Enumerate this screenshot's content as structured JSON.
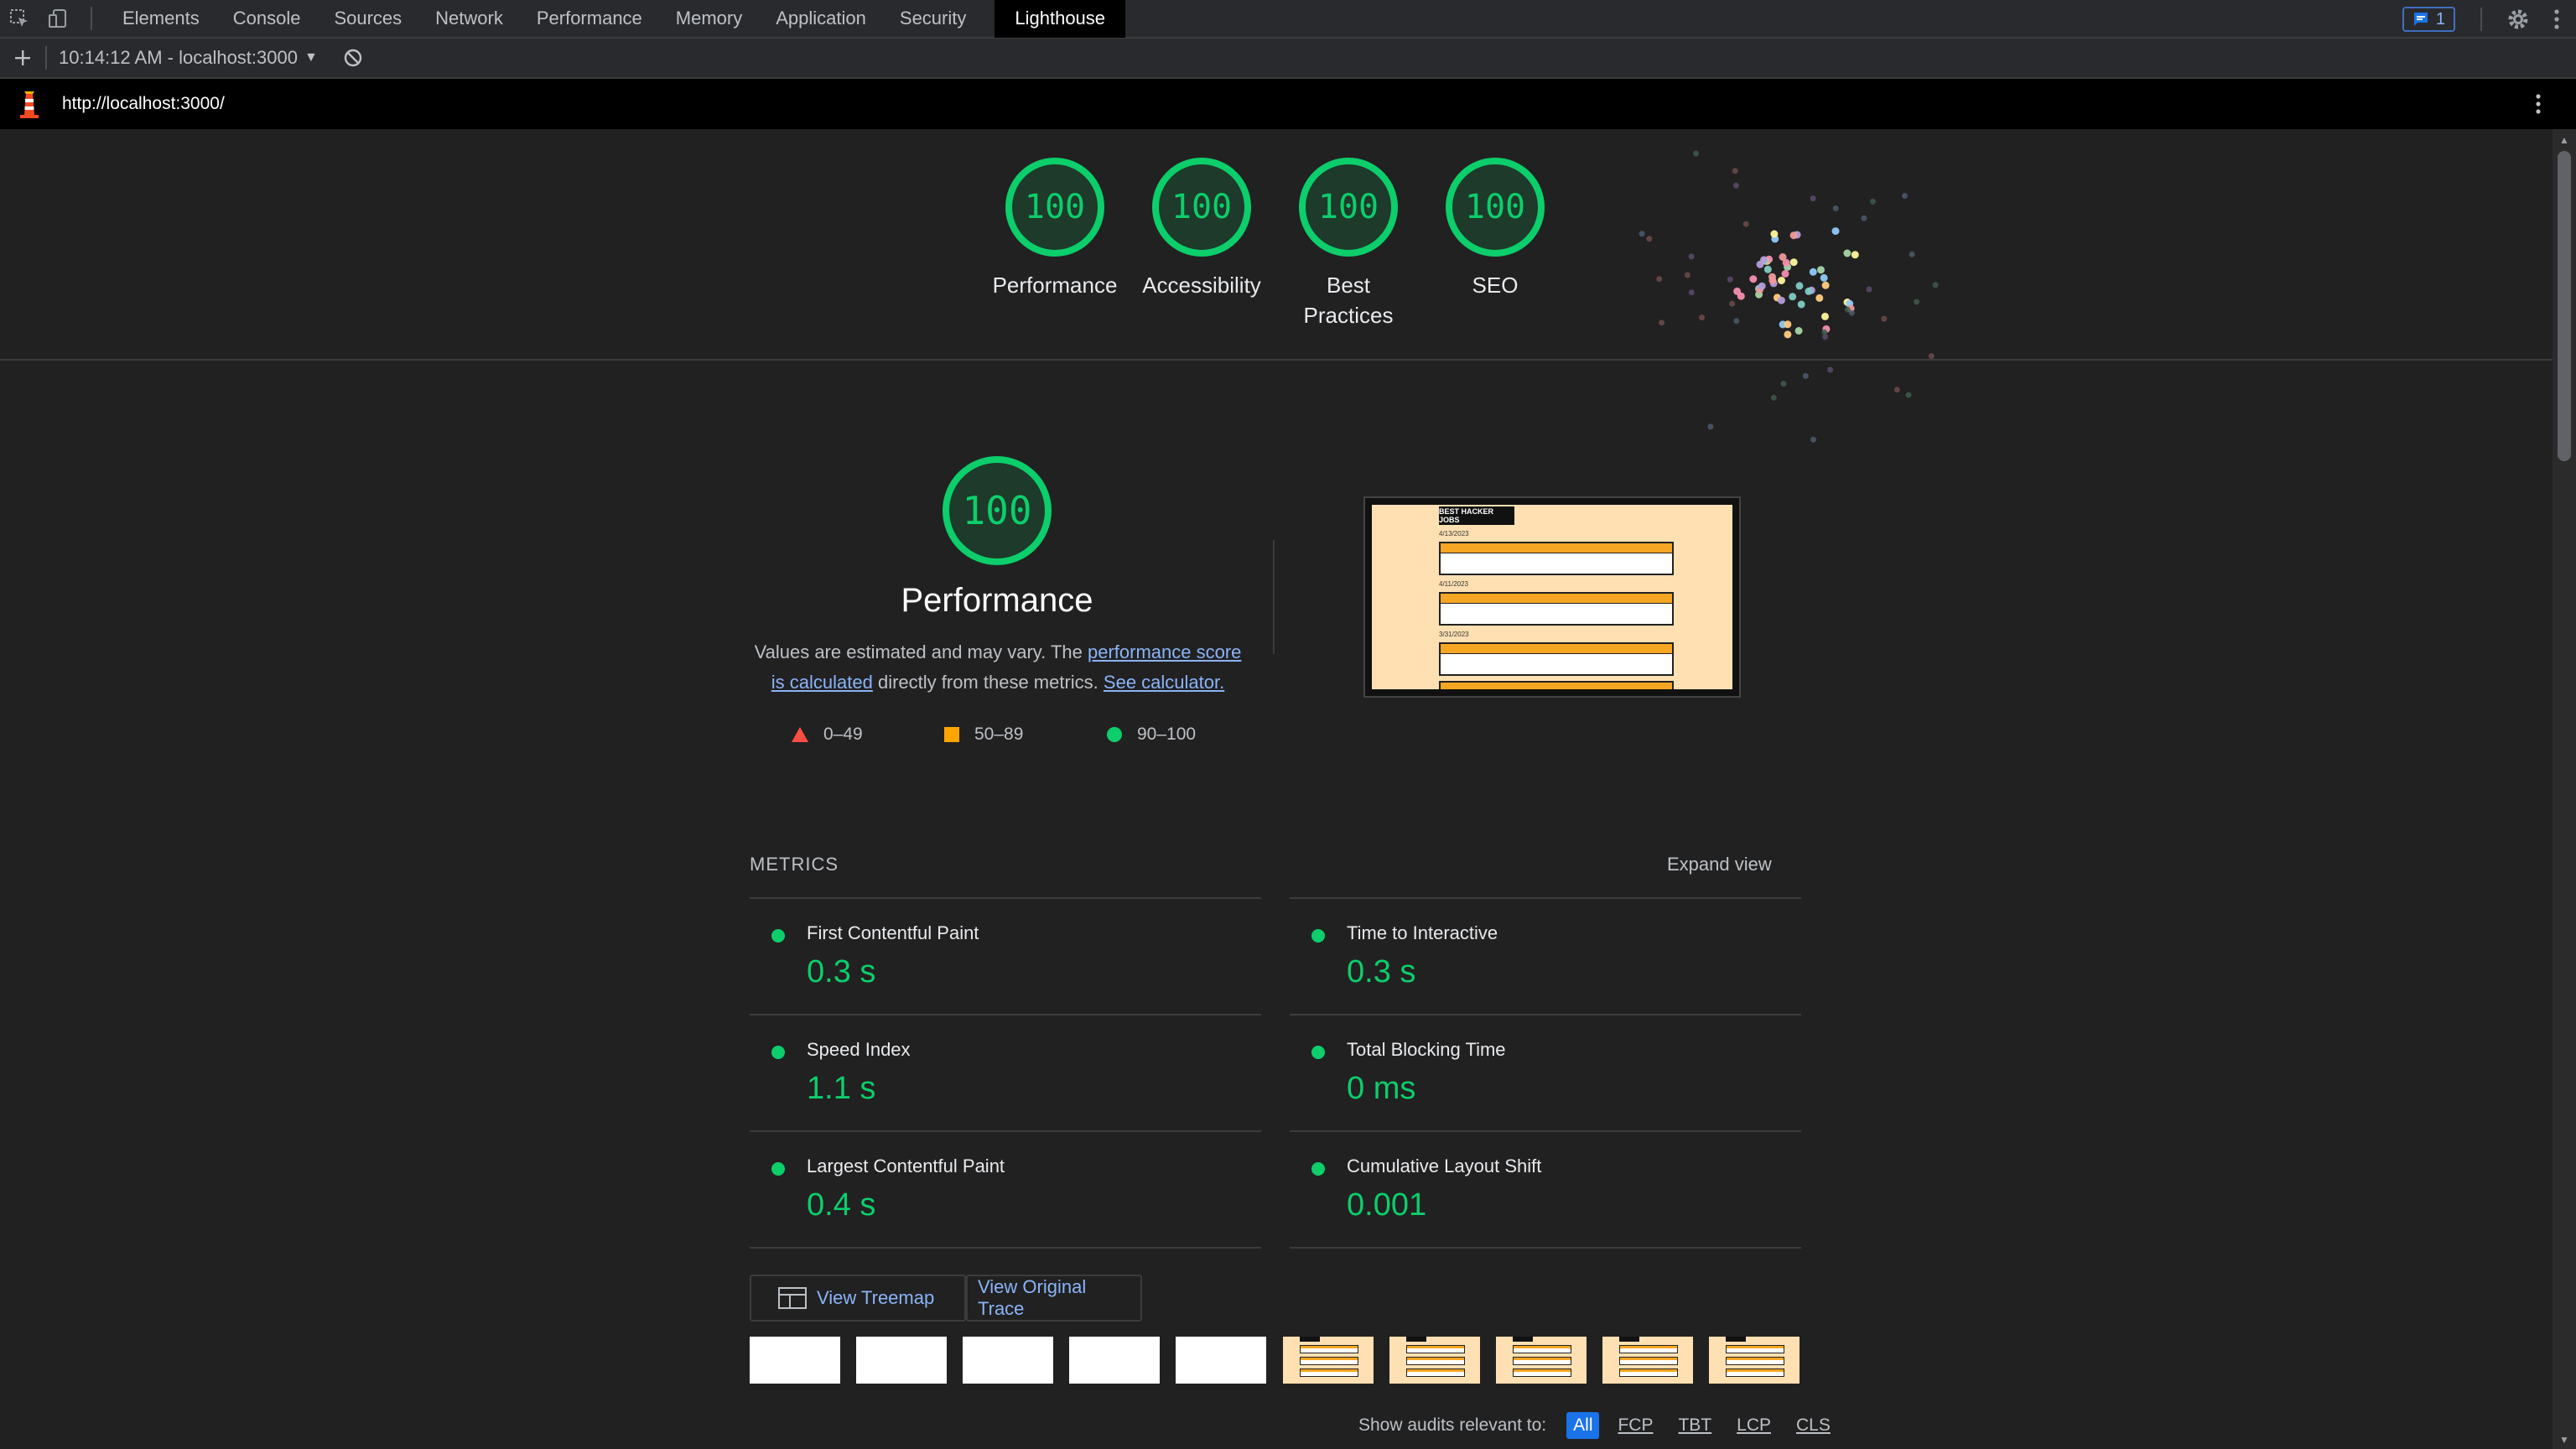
{
  "devtools": {
    "tabs": [
      {
        "label": "Elements"
      },
      {
        "label": "Console"
      },
      {
        "label": "Sources"
      },
      {
        "label": "Network"
      },
      {
        "label": "Performance"
      },
      {
        "label": "Memory"
      },
      {
        "label": "Application"
      },
      {
        "label": "Security"
      },
      {
        "label": "Lighthouse"
      }
    ],
    "active_tab": "Lighthouse",
    "issues_count": "1",
    "report_selector": "10:14:12 AM - localhost:3000",
    "url": "http://localhost:3000/"
  },
  "summary_gauges": [
    {
      "score": "100",
      "label": "Performance"
    },
    {
      "score": "100",
      "label": "Accessibility"
    },
    {
      "score": "100",
      "label": "Best Practices"
    },
    {
      "score": "100",
      "label": "SEO"
    }
  ],
  "performance": {
    "score": "100",
    "title": "Performance",
    "desc_1": "Values are estimated and may vary. The ",
    "desc_link_1": "performance score is calculated",
    "desc_2": " directly from these metrics. ",
    "desc_link_2": "See calculator.",
    "legend": [
      {
        "label": "0–49",
        "color": "#ff4e42"
      },
      {
        "label": "50–89",
        "color": "#ffa400"
      },
      {
        "label": "90–100",
        "color": "#0cce6b"
      }
    ],
    "screenshot": {
      "header": "BEST HACKER JOBS",
      "dates": [
        "4/13/2023",
        "4/11/2023",
        "3/31/2023"
      ]
    }
  },
  "metrics": {
    "title": "METRICS",
    "expand_label": "Expand view",
    "left": [
      {
        "name": "First Contentful Paint",
        "value": "0.3 s"
      },
      {
        "name": "Speed Index",
        "value": "1.1 s"
      },
      {
        "name": "Largest Contentful Paint",
        "value": "0.4 s"
      }
    ],
    "right": [
      {
        "name": "Time to Interactive",
        "value": "0.3 s"
      },
      {
        "name": "Total Blocking Time",
        "value": "0 ms"
      },
      {
        "name": "Cumulative Layout Shift",
        "value": "0.001"
      }
    ]
  },
  "buttons": {
    "treemap": "View Treemap",
    "trace": "View Original Trace"
  },
  "filter": {
    "label": "Show audits relevant to:",
    "chips": [
      "All",
      "FCP",
      "TBT",
      "LCP",
      "CLS"
    ],
    "active": "All"
  },
  "colors": {
    "pass": "#0cce6b",
    "link": "#8ab4f8",
    "accent": "#1a73e8"
  }
}
